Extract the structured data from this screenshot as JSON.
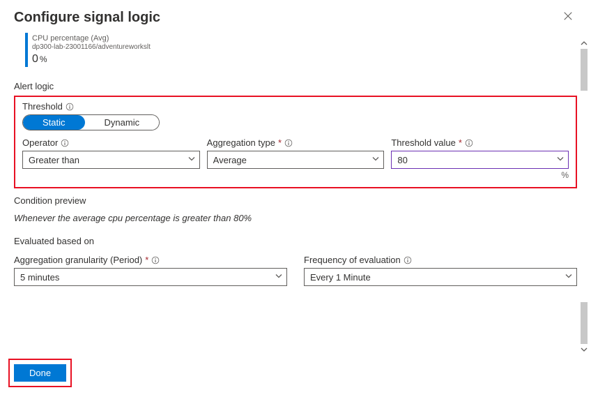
{
  "header": {
    "title": "Configure signal logic"
  },
  "metric": {
    "name": "CPU percentage (Avg)",
    "path": "dp300-lab-23001166/adventureworkslt",
    "value": "0",
    "unit": "%"
  },
  "alertLogic": {
    "section_label": "Alert logic",
    "threshold_label": "Threshold",
    "toggle": {
      "static": "Static",
      "dynamic": "Dynamic"
    },
    "operator": {
      "label": "Operator",
      "value": "Greater than"
    },
    "aggregation": {
      "label": "Aggregation type",
      "value": "Average"
    },
    "thresholdValue": {
      "label": "Threshold value",
      "value": "80",
      "unit": "%"
    }
  },
  "condition": {
    "label": "Condition preview",
    "text": "Whenever the average cpu percentage is greater than 80%"
  },
  "evaluated": {
    "label": "Evaluated based on",
    "granularity": {
      "label": "Aggregation granularity (Period)",
      "value": "5 minutes"
    },
    "frequency": {
      "label": "Frequency of evaluation",
      "value": "Every 1 Minute"
    }
  },
  "footer": {
    "done": "Done"
  }
}
